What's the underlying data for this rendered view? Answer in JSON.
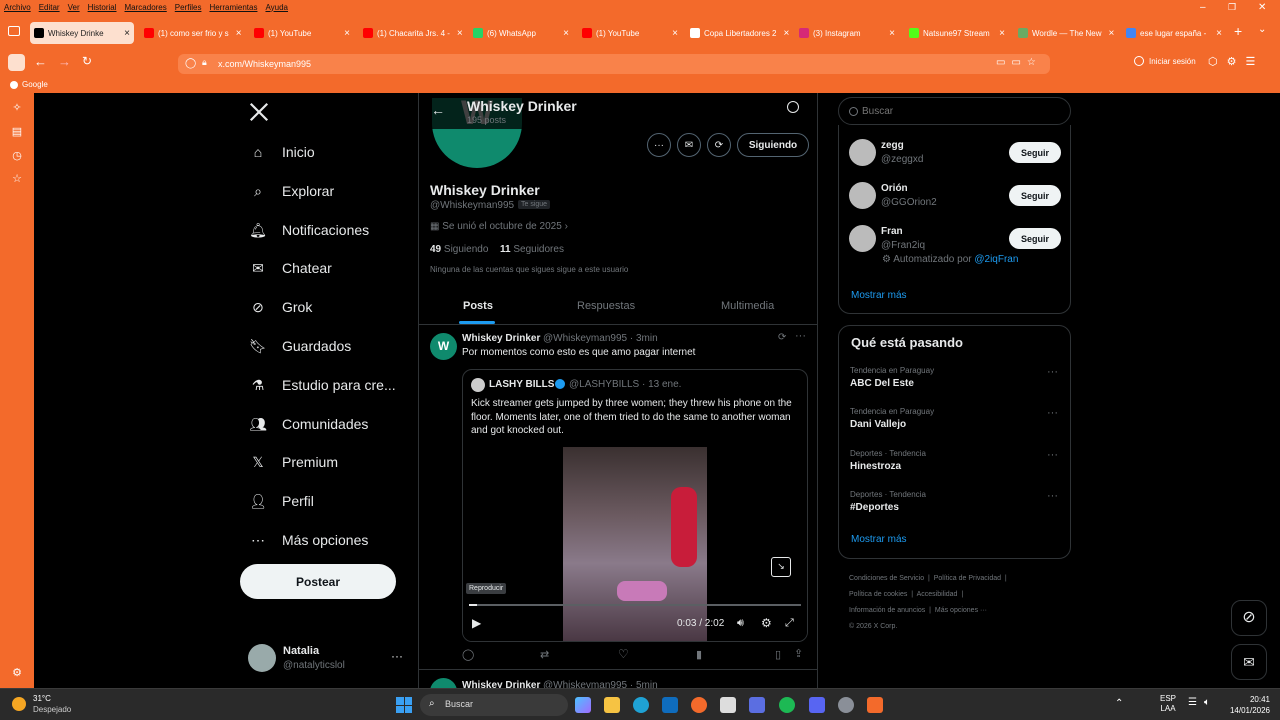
{
  "menubar": [
    "Archivo",
    "Editar",
    "Ver",
    "Historial",
    "Marcadores",
    "Perfiles",
    "Herramientas",
    "Ayuda"
  ],
  "tabs": [
    {
      "label": "Whiskey Drinke",
      "color": "#000000",
      "active": true
    },
    {
      "label": "(1) como ser frio y s",
      "color": "#ff0000"
    },
    {
      "label": "(1) YouTube",
      "color": "#ff0000"
    },
    {
      "label": "(1) Chacarita Jrs. 4 -",
      "color": "#ff0000"
    },
    {
      "label": "(6) WhatsApp",
      "color": "#25d366"
    },
    {
      "label": "(1) YouTube",
      "color": "#ff0000"
    },
    {
      "label": "Copa Libertadores 2",
      "color": "#ffffff"
    },
    {
      "label": "(3) Instagram",
      "color": "#d62976"
    },
    {
      "label": "Natsune97 Stream",
      "color": "#53fc18"
    },
    {
      "label": "Wordle — The New",
      "color": "#6aaa64"
    },
    {
      "label": "ese lugar españa -",
      "color": "#4285f4"
    }
  ],
  "url": "x.com/Whiskeyman995",
  "signin_label": "Iniciar sesión",
  "bookmark_google": "Google",
  "nav": {
    "items": [
      "Inicio",
      "Explorar",
      "Notificaciones",
      "Chatear",
      "Grok",
      "Guardados",
      "Estudio para cre...",
      "Comunidades",
      "Premium",
      "Perfil",
      "Más opciones"
    ],
    "post_button": "Postear",
    "account_name": "Natalia",
    "account_handle": "@natalyticslol"
  },
  "profile": {
    "header_name": "Whiskey Drinker",
    "header_posts": "195 posts",
    "avatar_letter": "W",
    "name": "Whiskey Drinker",
    "handle": "@Whiskeyman995",
    "follows_you": "Te sigue",
    "joined": "Se unió el octubre de 2025",
    "following_count": "49",
    "following_label": "Siguiendo",
    "followers_count": "11",
    "followers_label": "Seguidores",
    "mutuals": "Ninguna de las cuentas que sigues sigue a este usuario",
    "following_button": "Siguiendo",
    "tabs": [
      "Posts",
      "Respuestas",
      "Multimedia"
    ]
  },
  "tweet": {
    "name": "Whiskey Drinker",
    "handle_time": "@Whiskeyman995 · 3min",
    "text": "Por momentos como esto es que amo pagar internet",
    "quote_name": "LASHY BILLS",
    "quote_handle_time": "@LASHYBILLS · 13 ene.",
    "quote_text": "Kick streamer gets jumped by three women; they threw his phone on the floor. Moments later, one of them tried to do the same to another woman and got knocked out.",
    "tooltip": "Reproducir",
    "time": "0:03 / 2:02",
    "progress": 0.025
  },
  "next_tweet": {
    "name": "Whiskey Drinker",
    "handle_time": "@Whiskeyman995 · 5min"
  },
  "search_placeholder": "Buscar",
  "who_to_follow": [
    {
      "name": "zegg",
      "handle": "@zeggxd",
      "button": "Seguir"
    },
    {
      "name": "Orión",
      "handle": "@GGOrion2",
      "button": "Seguir"
    },
    {
      "name": "Fran",
      "handle": "@Fran2iq",
      "button": "Seguir",
      "auto": "Automatizado por",
      "auto_link": "@2iqFran"
    }
  ],
  "show_more": "Mostrar más",
  "trending_title": "Qué está pasando",
  "trends": [
    {
      "context": "Tendencia en Paraguay",
      "title": "ABC Del Este"
    },
    {
      "context": "Tendencia en Paraguay",
      "title": "Dani Vallejo"
    },
    {
      "context": "Deportes · Tendencia",
      "title": "Hinestroza"
    },
    {
      "context": "Deportes · Tendencia",
      "title": "#Deportes"
    }
  ],
  "show_more_2": "Mostrar más",
  "footer": {
    "links": [
      "Condiciones de Servicio",
      "Política de Privacidad",
      "Política de cookies",
      "Accesibilidad",
      "Información de anuncios",
      "Más opciones ···"
    ],
    "copyright": "© 2026 X Corp."
  },
  "taskbar": {
    "weather_temp": "31°C",
    "weather_desc": "Despejado",
    "search": "Buscar",
    "lang1": "ESP",
    "lang2": "LAA",
    "time": "20:41",
    "date": "14/01/2026"
  }
}
